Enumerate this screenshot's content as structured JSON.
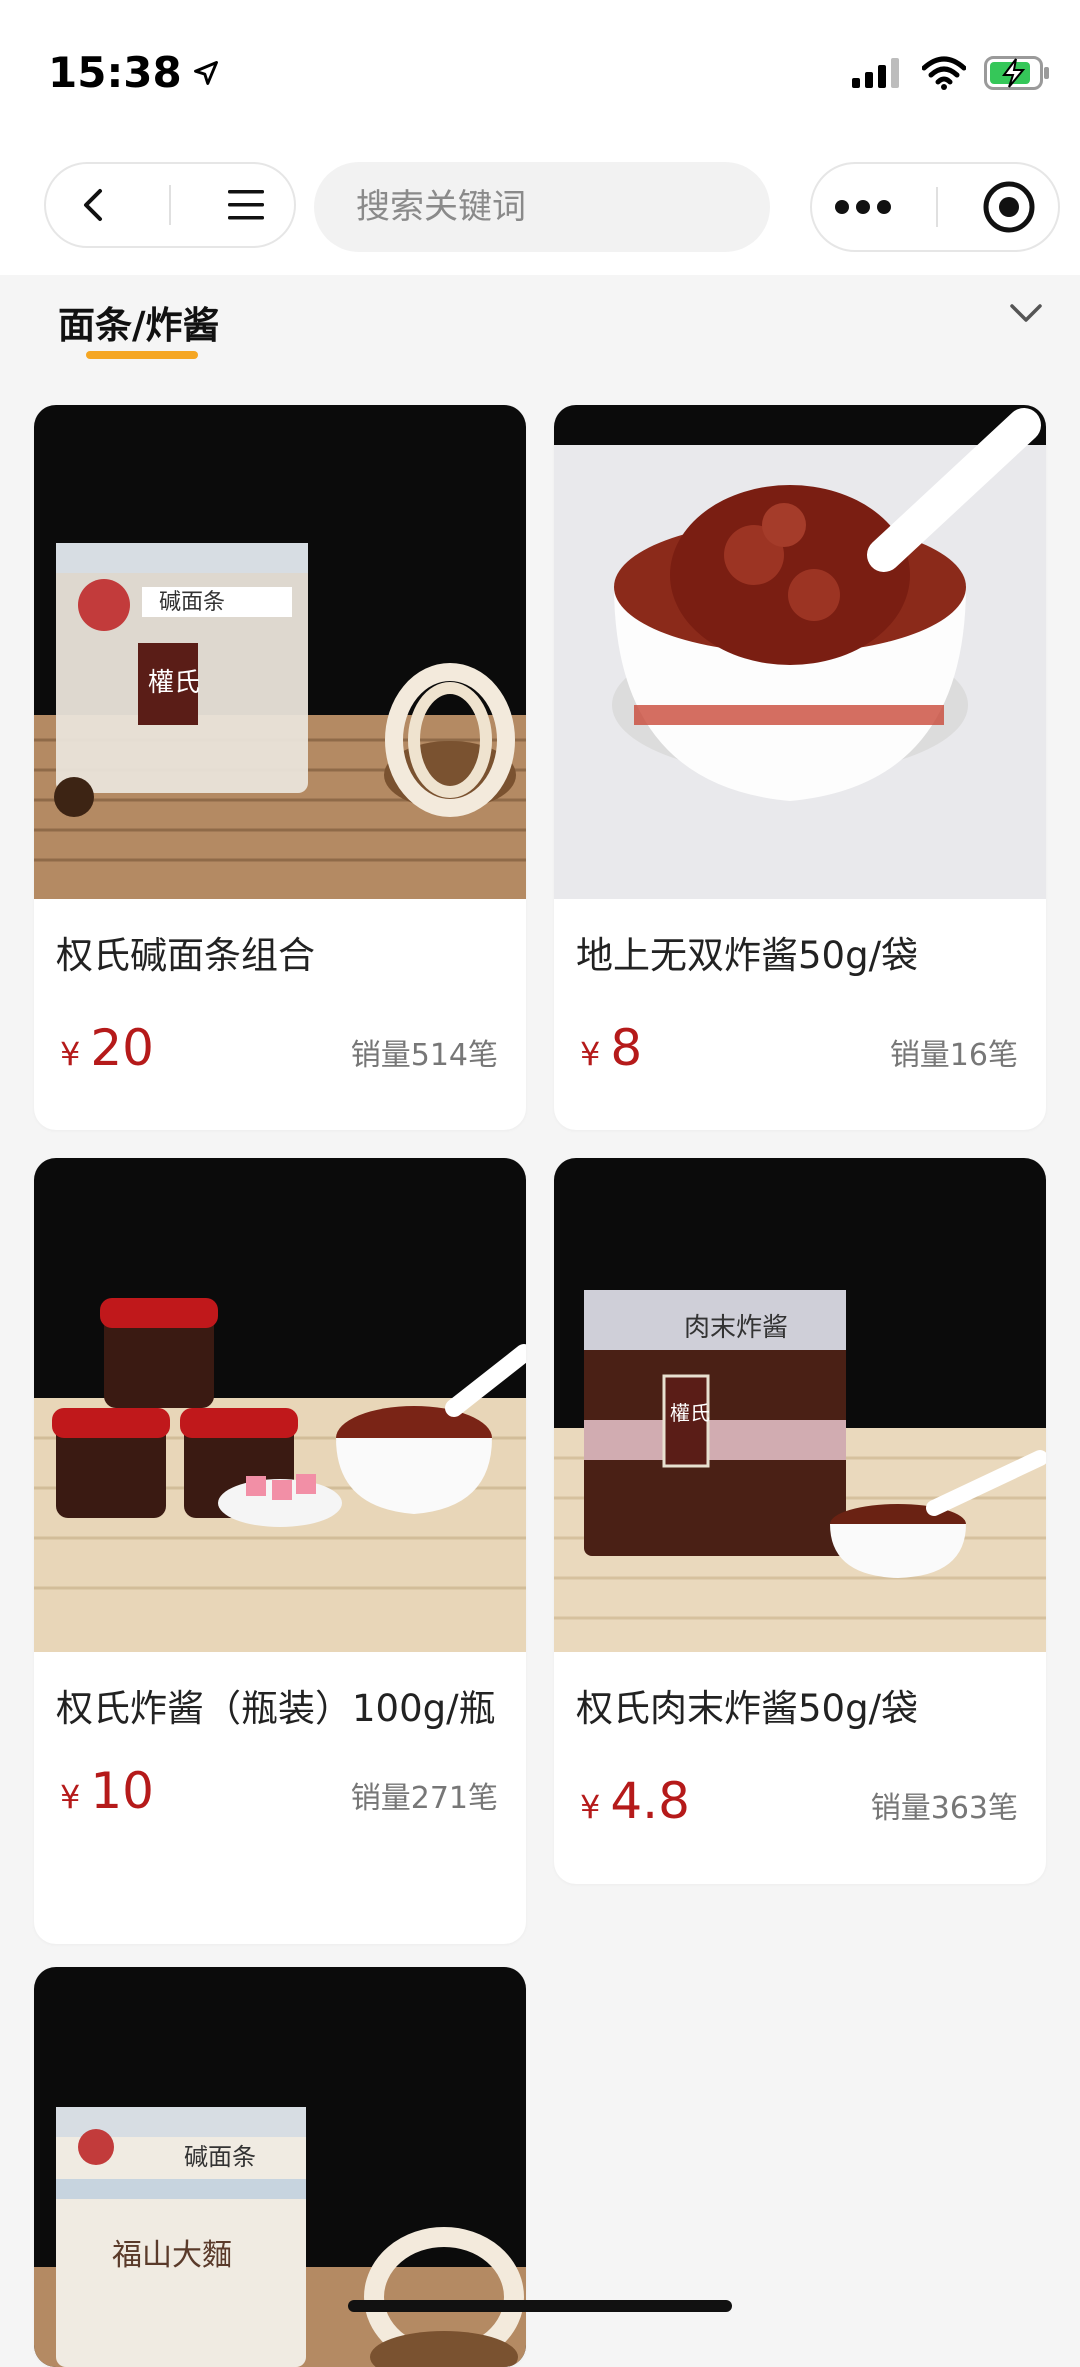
{
  "status": {
    "time": "15:38"
  },
  "nav": {
    "search_placeholder": "搜索关键词"
  },
  "category": {
    "active_tab": "面条/炸酱"
  },
  "currency_symbol": "¥",
  "products": [
    {
      "title": "权氏碱面条组合",
      "price": "20",
      "sales": "销量514笔"
    },
    {
      "title": "地上无双炸酱50g/袋",
      "price": "8",
      "sales": "销量16笔"
    },
    {
      "title": "权氏炸酱（瓶装）100g/瓶",
      "price": "10",
      "sales": "销量271笔"
    },
    {
      "title": "权氏肉末炸酱50g/袋",
      "price": "4.8",
      "sales": "销量363笔"
    }
  ],
  "image_labels": {
    "p1_pack": "碱面条",
    "p1_brand": "權氏",
    "p4_pack": "肉末炸酱",
    "p4_brand": "權氏",
    "p5_pack": "碱面条",
    "p5_brand": "福山大麵"
  },
  "colors": {
    "price": "#b51a1a",
    "tab_underline": "#f5a623",
    "background": "#f5f5f5"
  }
}
